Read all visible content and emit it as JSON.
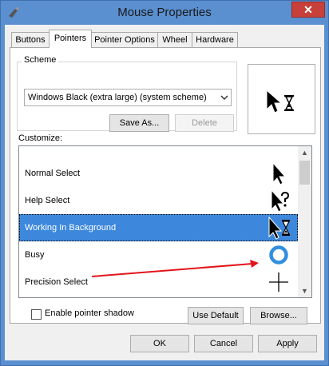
{
  "window": {
    "title": "Mouse Properties",
    "close_glyph": "✕"
  },
  "tabs": [
    {
      "label": "Buttons"
    },
    {
      "label": "Pointers",
      "active": true
    },
    {
      "label": "Pointer Options"
    },
    {
      "label": "Wheel"
    },
    {
      "label": "Hardware"
    }
  ],
  "scheme": {
    "legend": "Scheme",
    "selected": "Windows Black (extra large) (system scheme)",
    "save_as_label": "Save As...",
    "delete_label": "Delete"
  },
  "customize": {
    "label": "Customize:",
    "items": [
      {
        "label": "Normal Select",
        "icon": "arrow-cursor-icon"
      },
      {
        "label": "Help Select",
        "icon": "help-cursor-icon"
      },
      {
        "label": "Working In Background",
        "icon": "working-cursor-icon",
        "selected": true
      },
      {
        "label": "Busy",
        "icon": "busy-ring-icon"
      },
      {
        "label": "Precision Select",
        "icon": "crosshair-icon"
      }
    ]
  },
  "enable_shadow_label": "Enable pointer shadow",
  "use_default_label": "Use Default",
  "browse_label": "Browse...",
  "footer": {
    "ok_label": "OK",
    "cancel_label": "Cancel",
    "apply_label": "Apply"
  },
  "colors": {
    "selection": "#3d88dc",
    "annotation_arrow": "#e3141b",
    "busy_ring": "#2f8fe0",
    "close_button": "#c7413a"
  }
}
